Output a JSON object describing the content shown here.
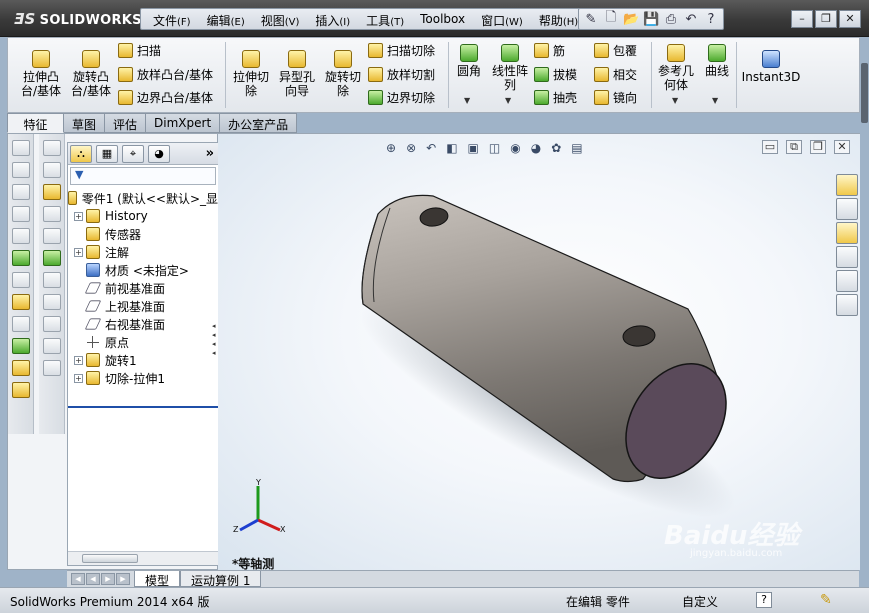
{
  "app": {
    "logo_text": "SOLIDWORKS"
  },
  "menu": [
    {
      "label": "文件",
      "accel": "(F)"
    },
    {
      "label": "编辑",
      "accel": "(E)"
    },
    {
      "label": "视图",
      "accel": "(V)"
    },
    {
      "label": "插入",
      "accel": "(I)"
    },
    {
      "label": "工具",
      "accel": "(T)"
    },
    {
      "label": "Toolbox",
      "accel": ""
    },
    {
      "label": "窗口",
      "accel": "(W)"
    },
    {
      "label": "帮助",
      "accel": "(H)"
    }
  ],
  "ribbon": {
    "extrude_boss": "拉伸凸\n台/基体",
    "revolve_boss": "旋转凸\n台/基体",
    "sweep": "扫描",
    "loft_boss": "放样凸台/基体",
    "boundary_boss": "边界凸台/基体",
    "extrude_cut": "拉伸切\n除",
    "hole_wizard": "异型孔\n向导",
    "revolve_cut": "旋转切\n除",
    "swept_cut": "扫描切除",
    "lofted_cut": "放样切割",
    "boundary_cut": "边界切除",
    "fillet": "圆角",
    "linear_pattern": "线性阵\n列",
    "rib": "筋",
    "draft": "拔模",
    "shell": "抽壳",
    "wrap": "包覆",
    "intersect": "相交",
    "mirror": "镜向",
    "ref_geometry": "参考几\n何体",
    "curves": "曲线",
    "instant3d": "Instant3D"
  },
  "tabs": [
    "特征",
    "草图",
    "评估",
    "DimXpert",
    "办公室产品"
  ],
  "feature_tree": {
    "root": "零件1 (默认<<默认>_显",
    "items": [
      {
        "label": "History",
        "expandable": true
      },
      {
        "label": "传感器",
        "expandable": false
      },
      {
        "label": "注解",
        "expandable": true
      },
      {
        "label": "材质 <未指定>",
        "expandable": false
      },
      {
        "label": "前视基准面",
        "expandable": false
      },
      {
        "label": "上视基准面",
        "expandable": false
      },
      {
        "label": "右视基准面",
        "expandable": false
      },
      {
        "label": "原点",
        "expandable": false
      },
      {
        "label": "旋转1",
        "expandable": true
      },
      {
        "label": "切除-拉伸1",
        "expandable": true
      }
    ]
  },
  "viewport": {
    "view_label": "*等轴测",
    "triad": {
      "x": "X",
      "y": "Y",
      "z": "Z"
    }
  },
  "bottom_tabs": [
    "模型",
    "运动算例 1"
  ],
  "status": {
    "product": "SolidWorks Premium 2014 x64 版",
    "mode": "在编辑 零件",
    "units": "自定义"
  },
  "watermark": {
    "brand": "Baidu经验",
    "url": "jingyan.baidu.com"
  },
  "colors": {
    "part_body": "#7d7873",
    "cut_face": "#5a4a5a",
    "accent": "#e8b830"
  }
}
